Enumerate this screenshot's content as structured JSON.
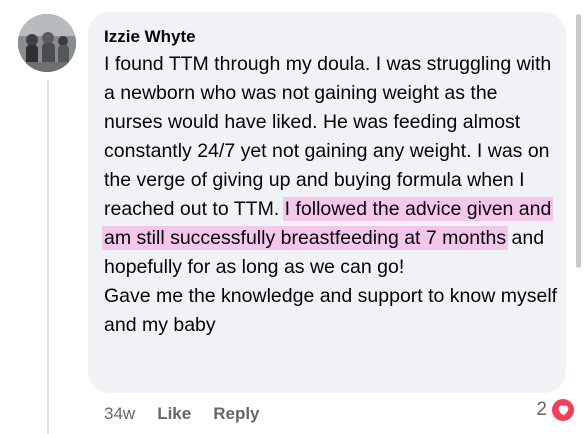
{
  "comment": {
    "author": "Izzie Whyte",
    "text_before": "I found TTM through my doula. I was struggling with a newborn who was not gaining weight as the nurses would have liked. He was feeding almost constantly 24/7 yet not gaining any weight. I was on the verge of giving up and buying formula when I reached out to TTM. ",
    "text_highlighted": "I followed the advice given and am still successfully breastfeeding at 7 months",
    "text_after": " and hopefully for as long as we can go!",
    "text_paragraph2": "Gave me the knowledge and support to know myself and my baby",
    "highlight_color": "#f5c6ec"
  },
  "meta": {
    "timestamp": "34w",
    "like_label": "Like",
    "reply_label": "Reply",
    "reaction_count": "2",
    "reaction_icon": "heart-icon",
    "reaction_color": "#f33e58"
  }
}
